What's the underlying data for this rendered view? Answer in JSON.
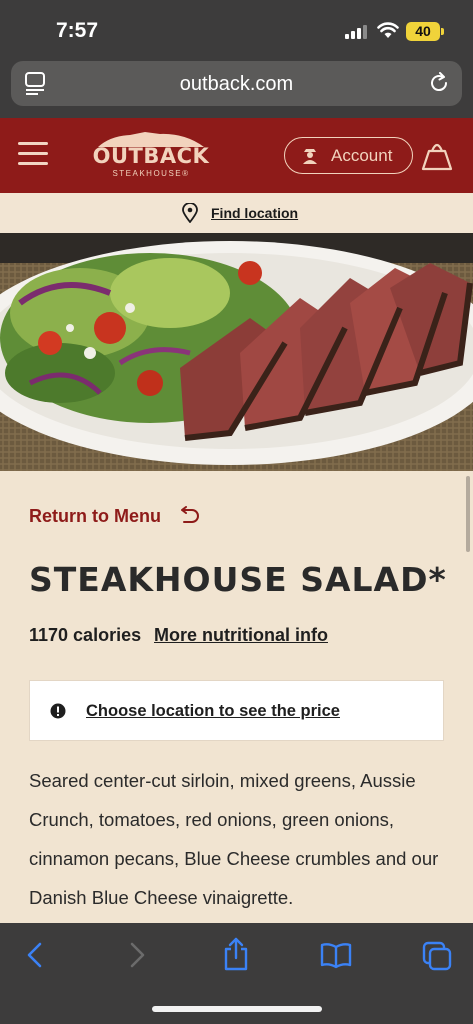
{
  "status_bar": {
    "time": "7:57",
    "battery": "40"
  },
  "browser": {
    "url": "outback.com"
  },
  "header": {
    "logo_word": "OUTBACK",
    "logo_sub": "STEAKHOUSE®",
    "account_label": "Account"
  },
  "find_location": {
    "label": "Find location"
  },
  "item": {
    "return_label": "Return to Menu",
    "title": "STEAKHOUSE SALAD*",
    "calories": "1170 calories",
    "nutrition_link": "More nutritional info",
    "price_prompt": "Choose location to see the price",
    "description": "Seared center-cut sirloin, mixed greens, Aussie Crunch, tomatoes, red onions, green onions, cinnamon pecans, Blue Cheese crumbles and our Danish Blue Cheese vinaigrette."
  },
  "colors": {
    "brand_red": "#8e1b19",
    "cream": "#f1e4d1",
    "safari_blue": "#3b82f6"
  }
}
